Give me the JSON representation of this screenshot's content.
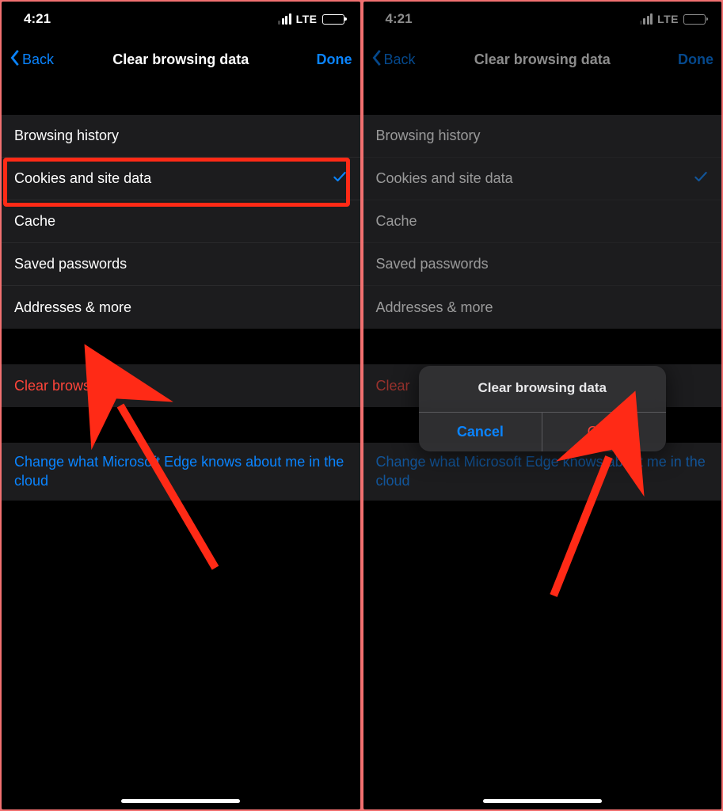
{
  "status": {
    "time": "4:21",
    "network": "LTE"
  },
  "nav": {
    "back": "Back",
    "title": "Clear browsing data",
    "done": "Done"
  },
  "data_types": {
    "browsing_history": "Browsing history",
    "cookies": "Cookies and site data",
    "cache": "Cache",
    "passwords": "Saved passwords",
    "addresses": "Addresses & more"
  },
  "actions": {
    "clear": "Clear browsing data",
    "cloud_link": "Change what Microsoft Edge knows about me in the cloud"
  },
  "sheet": {
    "title": "Clear browsing data",
    "cancel": "Cancel",
    "clear": "Clear",
    "peek_text": "Clear"
  }
}
